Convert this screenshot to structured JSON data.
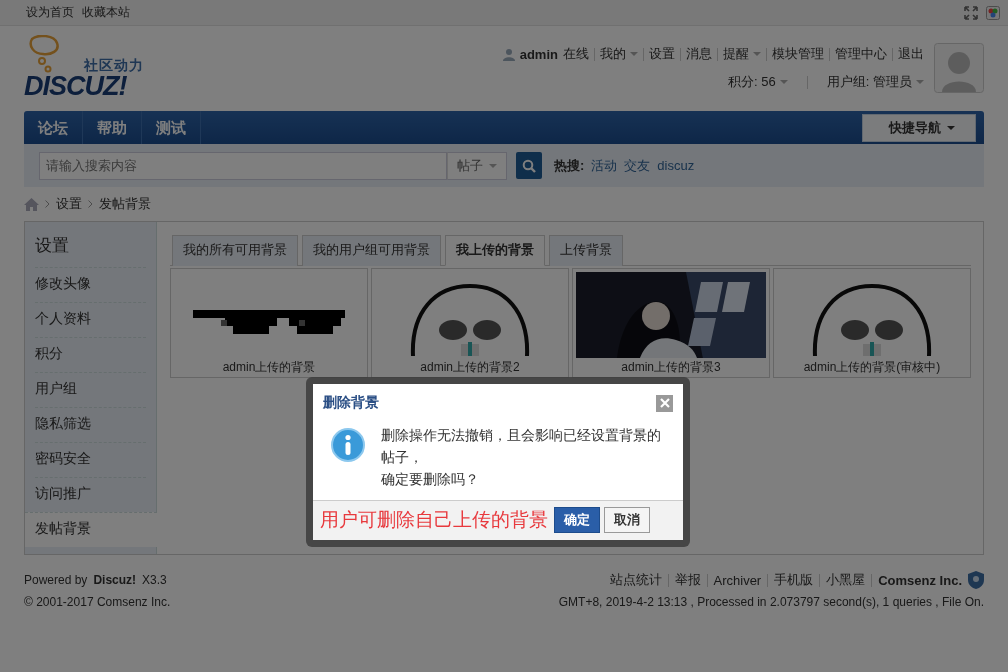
{
  "top_links": [
    "设为首页",
    "收藏本站"
  ],
  "logo": {
    "tagline": "社区动力",
    "wordmark": "DISCUZ!"
  },
  "user": {
    "name": "admin",
    "status": "在线"
  },
  "user_links": [
    {
      "label": "我的",
      "dropdown": true
    },
    {
      "label": "设置",
      "dropdown": false
    },
    {
      "label": "消息",
      "dropdown": false
    },
    {
      "label": "提醒",
      "dropdown": true
    },
    {
      "label": "模块管理",
      "dropdown": false
    },
    {
      "label": "管理中心",
      "dropdown": false
    },
    {
      "label": "退出",
      "dropdown": false
    }
  ],
  "user_stats": [
    {
      "label": "积分: 56",
      "dropdown": true
    },
    {
      "label": "用户组: 管理员",
      "dropdown": true
    }
  ],
  "nav": {
    "items": [
      "论坛",
      "帮助",
      "测试"
    ],
    "quick_nav": "快捷导航"
  },
  "search": {
    "placeholder": "请输入搜索内容",
    "scope": "帖子",
    "hot_label": "热搜:",
    "hot": [
      "活动",
      "交友",
      "discuz"
    ]
  },
  "breadcrumb": [
    "设置",
    "发帖背景"
  ],
  "sidebar": {
    "title": "设置",
    "items": [
      {
        "label": "修改头像",
        "selected": false
      },
      {
        "label": "个人资料",
        "selected": false
      },
      {
        "label": "积分",
        "selected": false
      },
      {
        "label": "用户组",
        "selected": false
      },
      {
        "label": "隐私筛选",
        "selected": false
      },
      {
        "label": "密码安全",
        "selected": false
      },
      {
        "label": "访问推广",
        "selected": false
      },
      {
        "label": "发帖背景",
        "selected": true
      }
    ]
  },
  "tabs": [
    {
      "label": "我的所有可用背景",
      "selected": false
    },
    {
      "label": "我的用户组可用背景",
      "selected": false
    },
    {
      "label": "我上传的背景",
      "selected": true
    },
    {
      "label": "上传背景",
      "selected": false
    }
  ],
  "backgrounds": [
    {
      "caption": "admin上传的背景",
      "kind": "glasses"
    },
    {
      "caption": "admin上传的背景2",
      "kind": "round"
    },
    {
      "caption": "admin上传的背景3",
      "kind": "room"
    },
    {
      "caption": "admin上传的背景(审核中)",
      "kind": "round"
    }
  ],
  "dialog": {
    "title": "删除背景",
    "message": [
      "删除操作无法撤销，且会影响已经设置背景的帖子，",
      "确定要删除吗？"
    ],
    "note": "用户可删除自己上传的背景",
    "buttons": [
      {
        "label": "确定",
        "primary": true
      },
      {
        "label": "取消",
        "primary": false
      }
    ]
  },
  "footer": {
    "powered": "Powered by **Discuz!** X3.3",
    "copyright": "© 2001-2017 Comsenz Inc.",
    "links": [
      {
        "label": "站点统计",
        "bold": false
      },
      {
        "label": "举报",
        "bold": false
      },
      {
        "label": "Archiver",
        "bold": false
      },
      {
        "label": "手机版",
        "bold": false
      },
      {
        "label": "小黑屋",
        "bold": false
      },
      {
        "label": "Comsenz Inc.",
        "bold": true
      }
    ],
    "status": "GMT+8, 2019-4-2 13:13 , Processed in 2.073797 second(s), 1 queries , File On."
  }
}
